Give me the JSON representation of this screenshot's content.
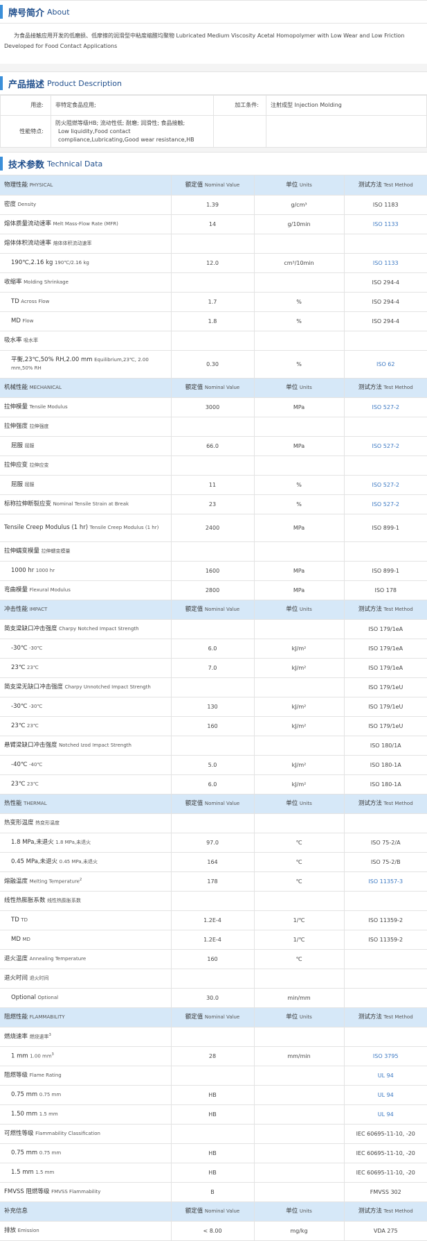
{
  "about": {
    "title_cn": "牌号简介",
    "title_en": "About",
    "text": "为食品接触应用开发的低磨损、低摩擦的润滑型中粘度缩醛均聚物  Lubricated Medium Viscosity Acetal Homopolymer with Low Wear and Low Friction Developed for Food Contact Applications"
  },
  "product": {
    "title_cn": "产品描述",
    "title_en": "Product Description",
    "use_label": "用途:",
    "use_value": "非特定食品应用;",
    "process_label": "加工条件:",
    "process_value": "注射成型  Injection Molding",
    "feature_label": "性能特点:",
    "feature_value_cn": "防火阻燃等级HB; 流动性低; 耐磨; 润滑性; 食品接触;",
    "feature_value_en": "Low liquidity,Food contact compliance,Lubricating,Good wear resistance,HB"
  },
  "tech": {
    "title_cn": "技术参数",
    "title_en": "Technical Data"
  },
  "header": {
    "nominal_cn": "额定值",
    "nominal_en": "Nominal Value",
    "units_cn": "单位",
    "units_en": "Units",
    "method_cn": "测试方法",
    "method_en": "Test Method"
  },
  "rows": [
    {
      "t": "h",
      "cn": "物理性能",
      "en": "PHYSICAL",
      "hh": 28
    },
    {
      "cn": "密度",
      "en": "Density",
      "v": "1.39",
      "u": "g/cm³",
      "m": "ISO 1183",
      "l": false,
      "hh": 28
    },
    {
      "cn": "熔体质量流动速率",
      "en": "Melt Mass-Flow Rate (MFR)",
      "v": "14",
      "u": "g/10min",
      "m": "ISO 1133",
      "l": true,
      "hh": 28
    },
    {
      "cn": "熔体体积流动速率",
      "en": "熔体体积流动速率",
      "v": "",
      "u": "",
      "m": "",
      "hh": 28
    },
    {
      "i": true,
      "cn": "190℃,2.16 kg",
      "en": "190℃/2.16 kg",
      "v": "12.0",
      "u": "cm³/10min",
      "m": "ISO 1133",
      "l": true,
      "hh": 28
    },
    {
      "cn": "收缩率",
      "en": "Molding Shrinkage",
      "v": "",
      "u": "",
      "m": "ISO 294-4",
      "l": false,
      "hh": 28
    },
    {
      "i": true,
      "cn": "TD",
      "en": "Across Flow",
      "v": "1.7",
      "u": "%",
      "m": "ISO 294-4",
      "l": false,
      "hh": 28
    },
    {
      "i": true,
      "cn": "MD",
      "en": "Flow",
      "v": "1.8",
      "u": "%",
      "m": "ISO 294-4",
      "l": false,
      "hh": 28
    },
    {
      "cn": "吸水率",
      "en": "吸水率",
      "v": "",
      "u": "",
      "m": "",
      "hh": 28
    },
    {
      "i": true,
      "cn": "平衡,23℃,50% RH,2.00 mm",
      "en": "Equilibrium,23℃, 2.00 mm,50% RH",
      "v": "0.30",
      "u": "%",
      "m": "ISO 62",
      "l": true,
      "hh": 40
    },
    {
      "t": "h",
      "cn": "机械性能",
      "en": "MECHANICAL",
      "hh": 28
    },
    {
      "cn": "拉伸模量",
      "en": "Tensile Modulus",
      "v": "3000",
      "u": "MPa",
      "m": "ISO 527-2",
      "l": true,
      "hh": 28
    },
    {
      "cn": "拉伸强度",
      "en": "拉伸强度",
      "v": "",
      "u": "",
      "m": "",
      "hh": 28
    },
    {
      "i": true,
      "cn": "屈服",
      "en": "屈服",
      "v": "66.0",
      "u": "MPa",
      "m": "ISO 527-2",
      "l": true,
      "hh": 28
    },
    {
      "cn": "拉伸应变",
      "en": "拉伸应变",
      "v": "",
      "u": "",
      "m": "",
      "hh": 28
    },
    {
      "i": true,
      "cn": "屈服",
      "en": "屈服",
      "v": "11",
      "u": "%",
      "m": "ISO 527-2",
      "l": true,
      "hh": 28
    },
    {
      "cn": "标称拉伸断裂应变",
      "en": "Nominal Tensile Strain at Break",
      "v": "23",
      "u": "%",
      "m": "ISO 527-2",
      "l": true,
      "hh": 28
    },
    {
      "cn": "Tensile Creep Modulus (1 hr)",
      "en": "Tensile Creep Modulus (1 hr)",
      "v": "2400",
      "u": "MPa",
      "m": "ISO 899-1",
      "l": false,
      "hh": 40
    },
    {
      "cn": "拉伸蠕变模量",
      "en": "拉伸蠕变模量",
      "v": "",
      "u": "",
      "m": "",
      "hh": 28
    },
    {
      "i": true,
      "cn": "1000 hr",
      "en": "1000 hr",
      "v": "1600",
      "u": "MPa",
      "m": "ISO 899-1",
      "l": false,
      "hh": 28
    },
    {
      "cn": "弯曲模量",
      "en": "Flexural Modulus",
      "v": "2800",
      "u": "MPa",
      "m": "ISO 178",
      "l": false,
      "hh": 28
    },
    {
      "t": "h",
      "cn": "冲击性能",
      "en": "IMPACT",
      "hh": 28
    },
    {
      "cn": "简支梁缺口冲击强度",
      "en": "Charpy Notched Impact Strength",
      "v": "",
      "u": "",
      "m": "ISO 179/1eA",
      "l": false,
      "hh": 28
    },
    {
      "i": true,
      "cn": "-30℃",
      "en": "-30℃",
      "v": "6.0",
      "u": "kJ/m²",
      "m": "ISO 179/1eA",
      "l": false,
      "hh": 28
    },
    {
      "i": true,
      "cn": "23℃",
      "en": "23℃",
      "v": "7.0",
      "u": "kJ/m²",
      "m": "ISO 179/1eA",
      "l": false,
      "hh": 28
    },
    {
      "cn": "简支梁无缺口冲击强度",
      "en": "Charpy Unnotched Impact Strength",
      "v": "",
      "u": "",
      "m": "ISO 179/1eU",
      "l": false,
      "hh": 28
    },
    {
      "i": true,
      "cn": "-30℃",
      "en": "-30℃",
      "v": "130",
      "u": "kJ/m²",
      "m": "ISO 179/1eU",
      "l": false,
      "hh": 28
    },
    {
      "i": true,
      "cn": "23℃",
      "en": "23℃",
      "v": "160",
      "u": "kJ/m²",
      "m": "ISO 179/1eU",
      "l": false,
      "hh": 28
    },
    {
      "cn": "悬臂梁缺口冲击强度",
      "en": "Notched Izod Impact Strength",
      "v": "",
      "u": "",
      "m": "ISO 180/1A",
      "l": false,
      "hh": 28
    },
    {
      "i": true,
      "cn": "-40℃",
      "en": "-40℃",
      "v": "5.0",
      "u": "kJ/m²",
      "m": "ISO 180-1A",
      "l": false,
      "hh": 28
    },
    {
      "i": true,
      "cn": "23℃",
      "en": "23℃",
      "v": "6.0",
      "u": "kJ/m²",
      "m": "ISO 180-1A",
      "l": false,
      "hh": 28
    },
    {
      "t": "h",
      "cn": "热性能",
      "en": "THERMAL",
      "hh": 28
    },
    {
      "cn": "热变形温度",
      "en": "热变形温度",
      "v": "",
      "u": "",
      "m": "",
      "hh": 28
    },
    {
      "i": true,
      "cn": "1.8 MPa,未退火",
      "en": "1.8 MPa,未退火",
      "v": "97.0",
      "u": "℃",
      "m": "ISO 75-2/A",
      "l": false,
      "hh": 28
    },
    {
      "i": true,
      "cn": "0.45 MPa,未退火",
      "en": "0.45 MPa,未退火",
      "v": "164",
      "u": "℃",
      "m": "ISO 75-2/B",
      "l": false,
      "hh": 28
    },
    {
      "cn": "熔融温度",
      "en": "Melting Temperature",
      "sup": "2",
      "v": "178",
      "u": "℃",
      "m": "ISO 11357-3",
      "l": true,
      "hh": 28
    },
    {
      "cn": "线性热膨胀系数",
      "en": "线性热膨胀系数",
      "v": "",
      "u": "",
      "m": "",
      "hh": 28
    },
    {
      "i": true,
      "cn": "TD",
      "en": "TD",
      "v": "1.2E-4",
      "u": "1/℃",
      "m": "ISO 11359-2",
      "l": false,
      "hh": 28
    },
    {
      "i": true,
      "cn": "MD",
      "en": "MD",
      "v": "1.2E-4",
      "u": "1/℃",
      "m": "ISO 11359-2",
      "l": false,
      "hh": 28
    },
    {
      "cn": "退火温度",
      "en": "Annealing Temperature",
      "v": "160",
      "u": "℃",
      "m": "",
      "hh": 28
    },
    {
      "cn": "退火时间",
      "en": "退火时间",
      "v": "",
      "u": "",
      "m": "",
      "hh": 28
    },
    {
      "i": true,
      "cn": "Optional",
      "en": "Optional",
      "v": "30.0",
      "u": "min/mm",
      "m": "",
      "hh": 28
    },
    {
      "t": "h",
      "cn": "阻燃性能",
      "en": "FLAMMABILITY",
      "hh": 28
    },
    {
      "cn": "燃烧速率",
      "en": "燃烧速率",
      "sup": "3",
      "v": "",
      "u": "",
      "m": "",
      "hh": 28
    },
    {
      "i": true,
      "cn": "1 mm",
      "en": "1.00 mm",
      "sup": "3",
      "v": "28",
      "u": "mm/min",
      "m": "ISO 3795",
      "l": true,
      "hh": 28
    },
    {
      "cn": "阻燃等级",
      "en": "Flame Rating",
      "v": "",
      "u": "",
      "m": "UL 94",
      "l": true,
      "hh": 28
    },
    {
      "i": true,
      "cn": "0.75 mm",
      "en": "0.75 mm",
      "v": "HB",
      "u": "",
      "m": "UL 94",
      "l": true,
      "hh": 28
    },
    {
      "i": true,
      "cn": "1.50 mm",
      "en": "1.5 mm",
      "v": "HB",
      "u": "",
      "m": "UL 94",
      "l": true,
      "hh": 28
    },
    {
      "cn": "可燃性等级",
      "en": "Flammability Classification",
      "v": "",
      "u": "",
      "m": "IEC 60695-11-10, -20",
      "l": false,
      "hh": 28
    },
    {
      "i": true,
      "cn": "0.75 mm",
      "en": "0.75 mm",
      "v": "HB",
      "u": "",
      "m": "IEC 60695-11-10, -20",
      "l": false,
      "hh": 28
    },
    {
      "i": true,
      "cn": "1.5 mm",
      "en": "1.5 mm",
      "v": "HB",
      "u": "",
      "m": "IEC 60695-11-10, -20",
      "l": false,
      "hh": 28
    },
    {
      "cn": "FMVSS 阻燃等级",
      "en": "FMVSS Flammability",
      "v": "B",
      "u": "",
      "m": "FMVSS 302",
      "l": false,
      "hh": 28
    },
    {
      "t": "h",
      "cn": "补充信息",
      "en": "",
      "hh": 28
    },
    {
      "cn": "排放",
      "en": "Emission",
      "v": "< 8.00",
      "u": "mg/kg",
      "m": "VDA 275",
      "l": false,
      "hh": 28
    }
  ]
}
